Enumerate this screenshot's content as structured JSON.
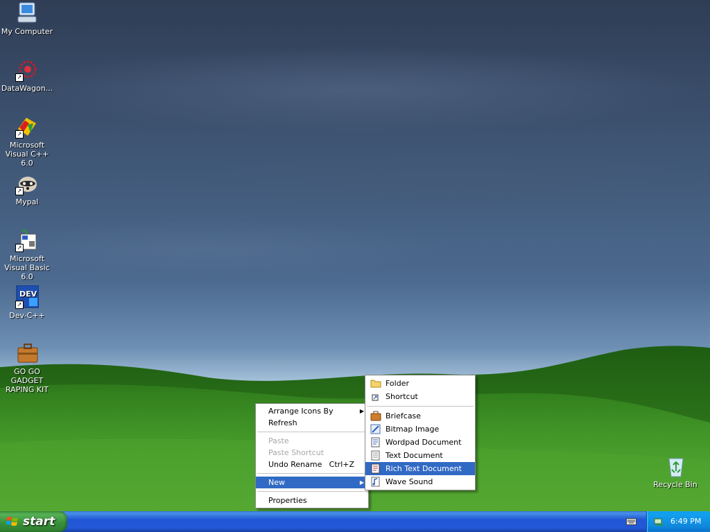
{
  "desktop": {
    "icons": [
      {
        "label": "My Computer",
        "icon": "my-computer-icon"
      },
      {
        "label": "DataWagon...",
        "icon": "datawagon-icon"
      },
      {
        "label": "Microsoft Visual C++ 6.0",
        "icon": "visual-cpp-icon"
      },
      {
        "label": "Mypal",
        "icon": "mypal-raccoon-icon"
      },
      {
        "label": "Microsoft Visual Basic 6.0",
        "icon": "visual-basic-icon"
      },
      {
        "label": "Dev-C++",
        "icon": "dev-cpp-icon"
      },
      {
        "label": "GO GO GADGET RAPING KIT",
        "icon": "briefcase-icon"
      },
      {
        "label": "Recycle Bin",
        "icon": "recycle-bin-icon"
      }
    ],
    "dev_icon_text": "DEV"
  },
  "context_menu": {
    "items": [
      {
        "label": "Arrange Icons By",
        "submenu": true
      },
      {
        "label": "Refresh"
      },
      {
        "label": "Paste",
        "disabled": true
      },
      {
        "label": "Paste Shortcut",
        "disabled": true
      },
      {
        "label": "Undo Rename",
        "shortcut": "Ctrl+Z"
      },
      {
        "label": "New",
        "submenu": true,
        "highlighted": true
      },
      {
        "label": "Properties"
      }
    ]
  },
  "new_submenu": {
    "items": [
      {
        "label": "Folder",
        "icon": "folder-icon"
      },
      {
        "label": "Shortcut",
        "icon": "shortcut-icon"
      },
      {
        "label": "Briefcase",
        "icon": "briefcase-icon"
      },
      {
        "label": "Bitmap Image",
        "icon": "bitmap-icon"
      },
      {
        "label": "Wordpad Document",
        "icon": "wordpad-icon"
      },
      {
        "label": "Text Document",
        "icon": "text-document-icon"
      },
      {
        "label": "Rich Text Document",
        "icon": "rich-text-icon",
        "highlighted": true
      },
      {
        "label": "Wave Sound",
        "icon": "wave-sound-icon"
      }
    ]
  },
  "taskbar": {
    "start_label": "start",
    "clock": "6:49 PM"
  },
  "colors": {
    "menu_highlight": "#316ac5",
    "taskbar_blue": "#2257d5",
    "start_green": "#388e38",
    "tray_blue": "#0f8ade"
  }
}
